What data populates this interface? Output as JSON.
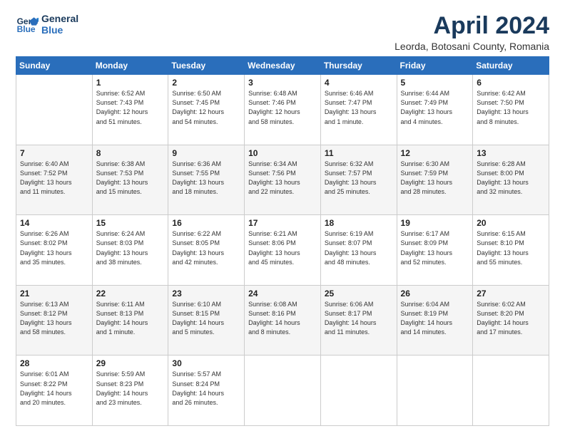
{
  "logo": {
    "line1": "General",
    "line2": "Blue"
  },
  "title": "April 2024",
  "subtitle": "Leorda, Botosani County, Romania",
  "weekdays": [
    "Sunday",
    "Monday",
    "Tuesday",
    "Wednesday",
    "Thursday",
    "Friday",
    "Saturday"
  ],
  "weeks": [
    [
      {
        "day": "",
        "info": ""
      },
      {
        "day": "1",
        "info": "Sunrise: 6:52 AM\nSunset: 7:43 PM\nDaylight: 12 hours\nand 51 minutes."
      },
      {
        "day": "2",
        "info": "Sunrise: 6:50 AM\nSunset: 7:45 PM\nDaylight: 12 hours\nand 54 minutes."
      },
      {
        "day": "3",
        "info": "Sunrise: 6:48 AM\nSunset: 7:46 PM\nDaylight: 12 hours\nand 58 minutes."
      },
      {
        "day": "4",
        "info": "Sunrise: 6:46 AM\nSunset: 7:47 PM\nDaylight: 13 hours\nand 1 minute."
      },
      {
        "day": "5",
        "info": "Sunrise: 6:44 AM\nSunset: 7:49 PM\nDaylight: 13 hours\nand 4 minutes."
      },
      {
        "day": "6",
        "info": "Sunrise: 6:42 AM\nSunset: 7:50 PM\nDaylight: 13 hours\nand 8 minutes."
      }
    ],
    [
      {
        "day": "7",
        "info": "Sunrise: 6:40 AM\nSunset: 7:52 PM\nDaylight: 13 hours\nand 11 minutes."
      },
      {
        "day": "8",
        "info": "Sunrise: 6:38 AM\nSunset: 7:53 PM\nDaylight: 13 hours\nand 15 minutes."
      },
      {
        "day": "9",
        "info": "Sunrise: 6:36 AM\nSunset: 7:55 PM\nDaylight: 13 hours\nand 18 minutes."
      },
      {
        "day": "10",
        "info": "Sunrise: 6:34 AM\nSunset: 7:56 PM\nDaylight: 13 hours\nand 22 minutes."
      },
      {
        "day": "11",
        "info": "Sunrise: 6:32 AM\nSunset: 7:57 PM\nDaylight: 13 hours\nand 25 minutes."
      },
      {
        "day": "12",
        "info": "Sunrise: 6:30 AM\nSunset: 7:59 PM\nDaylight: 13 hours\nand 28 minutes."
      },
      {
        "day": "13",
        "info": "Sunrise: 6:28 AM\nSunset: 8:00 PM\nDaylight: 13 hours\nand 32 minutes."
      }
    ],
    [
      {
        "day": "14",
        "info": "Sunrise: 6:26 AM\nSunset: 8:02 PM\nDaylight: 13 hours\nand 35 minutes."
      },
      {
        "day": "15",
        "info": "Sunrise: 6:24 AM\nSunset: 8:03 PM\nDaylight: 13 hours\nand 38 minutes."
      },
      {
        "day": "16",
        "info": "Sunrise: 6:22 AM\nSunset: 8:05 PM\nDaylight: 13 hours\nand 42 minutes."
      },
      {
        "day": "17",
        "info": "Sunrise: 6:21 AM\nSunset: 8:06 PM\nDaylight: 13 hours\nand 45 minutes."
      },
      {
        "day": "18",
        "info": "Sunrise: 6:19 AM\nSunset: 8:07 PM\nDaylight: 13 hours\nand 48 minutes."
      },
      {
        "day": "19",
        "info": "Sunrise: 6:17 AM\nSunset: 8:09 PM\nDaylight: 13 hours\nand 52 minutes."
      },
      {
        "day": "20",
        "info": "Sunrise: 6:15 AM\nSunset: 8:10 PM\nDaylight: 13 hours\nand 55 minutes."
      }
    ],
    [
      {
        "day": "21",
        "info": "Sunrise: 6:13 AM\nSunset: 8:12 PM\nDaylight: 13 hours\nand 58 minutes."
      },
      {
        "day": "22",
        "info": "Sunrise: 6:11 AM\nSunset: 8:13 PM\nDaylight: 14 hours\nand 1 minute."
      },
      {
        "day": "23",
        "info": "Sunrise: 6:10 AM\nSunset: 8:15 PM\nDaylight: 14 hours\nand 5 minutes."
      },
      {
        "day": "24",
        "info": "Sunrise: 6:08 AM\nSunset: 8:16 PM\nDaylight: 14 hours\nand 8 minutes."
      },
      {
        "day": "25",
        "info": "Sunrise: 6:06 AM\nSunset: 8:17 PM\nDaylight: 14 hours\nand 11 minutes."
      },
      {
        "day": "26",
        "info": "Sunrise: 6:04 AM\nSunset: 8:19 PM\nDaylight: 14 hours\nand 14 minutes."
      },
      {
        "day": "27",
        "info": "Sunrise: 6:02 AM\nSunset: 8:20 PM\nDaylight: 14 hours\nand 17 minutes."
      }
    ],
    [
      {
        "day": "28",
        "info": "Sunrise: 6:01 AM\nSunset: 8:22 PM\nDaylight: 14 hours\nand 20 minutes."
      },
      {
        "day": "29",
        "info": "Sunrise: 5:59 AM\nSunset: 8:23 PM\nDaylight: 14 hours\nand 23 minutes."
      },
      {
        "day": "30",
        "info": "Sunrise: 5:57 AM\nSunset: 8:24 PM\nDaylight: 14 hours\nand 26 minutes."
      },
      {
        "day": "",
        "info": ""
      },
      {
        "day": "",
        "info": ""
      },
      {
        "day": "",
        "info": ""
      },
      {
        "day": "",
        "info": ""
      }
    ]
  ]
}
